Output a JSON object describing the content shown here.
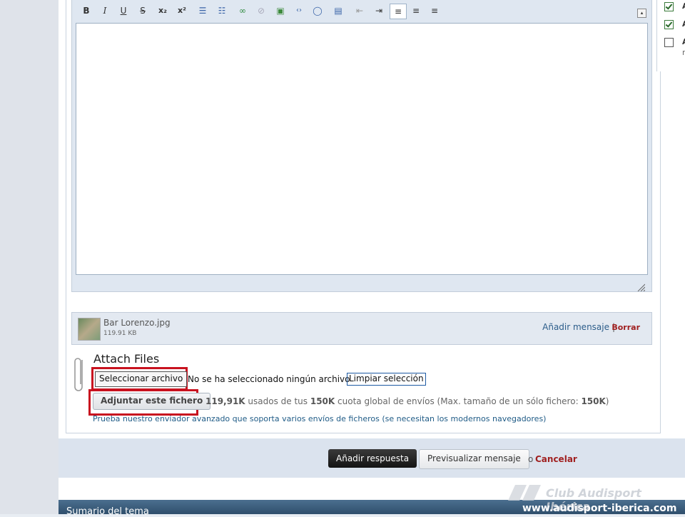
{
  "editor": {
    "toolbar": [
      {
        "name": "bold-button",
        "glyph": "B"
      },
      {
        "name": "italic-button",
        "glyph": "I"
      },
      {
        "name": "underline-button",
        "glyph": "U"
      },
      {
        "name": "strikethrough-button",
        "glyph": "S"
      },
      {
        "name": "subscript-button",
        "glyph": "x₂"
      },
      {
        "name": "superscript-button",
        "glyph": "x²"
      },
      {
        "name": "bulleted-list-icon",
        "glyph": "☰"
      },
      {
        "name": "numbered-list-icon",
        "glyph": "☷"
      },
      {
        "name": "link-icon",
        "glyph": "∞"
      },
      {
        "name": "unlink-icon",
        "glyph": "⊘"
      },
      {
        "name": "image-icon",
        "glyph": "▣"
      },
      {
        "name": "code-icon",
        "glyph": "‹›"
      },
      {
        "name": "quote-icon",
        "glyph": "◯"
      },
      {
        "name": "media-icon",
        "glyph": "▤"
      },
      {
        "name": "outdent-icon",
        "glyph": "⇤"
      },
      {
        "name": "indent-icon",
        "glyph": "⇥"
      },
      {
        "name": "align-left-icon",
        "glyph": "≡"
      },
      {
        "name": "align-center-icon",
        "glyph": "≡"
      },
      {
        "name": "align-right-icon",
        "glyph": "≡"
      }
    ],
    "collapse_glyph": "▴"
  },
  "attachment": {
    "file_name": "Bar Lorenzo.jpg",
    "file_size": "119.91 KB",
    "insert_label": "Añadir mensaje",
    "separator": "|",
    "delete_label": "Borrar"
  },
  "attach_files": {
    "title": "Attach Files",
    "choose_file_label": "Seleccionar archivo",
    "no_file_text": "No se ha seleccionado ningún archivo",
    "clear_label": "Limpiar selección",
    "upload_label": "Adjuntar este fichero",
    "usage_used": "119,91K",
    "usage_text_1": " usados de tus ",
    "usage_quota": "150K",
    "usage_text_2": " cuota global de envíos (Max. tamaño de un sólo fichero: ",
    "usage_max": "150K",
    "usage_text_3": ")",
    "advanced_link": "Prueba nuestro enviador avanzado que soporta varios envíos de ficheros (se necesitan los modernos navegadores)"
  },
  "actions": {
    "submit_label": "Añadir respuesta",
    "preview_label": "Previsualizar mensaje",
    "or_text": "o",
    "cancel_label": "Cancelar"
  },
  "sidebar_right": {
    "options": [
      {
        "label": "A",
        "checked": true
      },
      {
        "label": "A",
        "checked": true
      },
      {
        "label": "A",
        "checked": false,
        "sub": "r"
      }
    ]
  },
  "footer": {
    "section_title": "Sumario del tema",
    "watermark_text": "Club Audisport Ibérica",
    "watermark_url": "www.audisport-iberica.com"
  },
  "colors": {
    "highlight": "#c8121f",
    "link": "#2c5d8a",
    "delete": "#a02020",
    "footer": "#3b5b79"
  }
}
